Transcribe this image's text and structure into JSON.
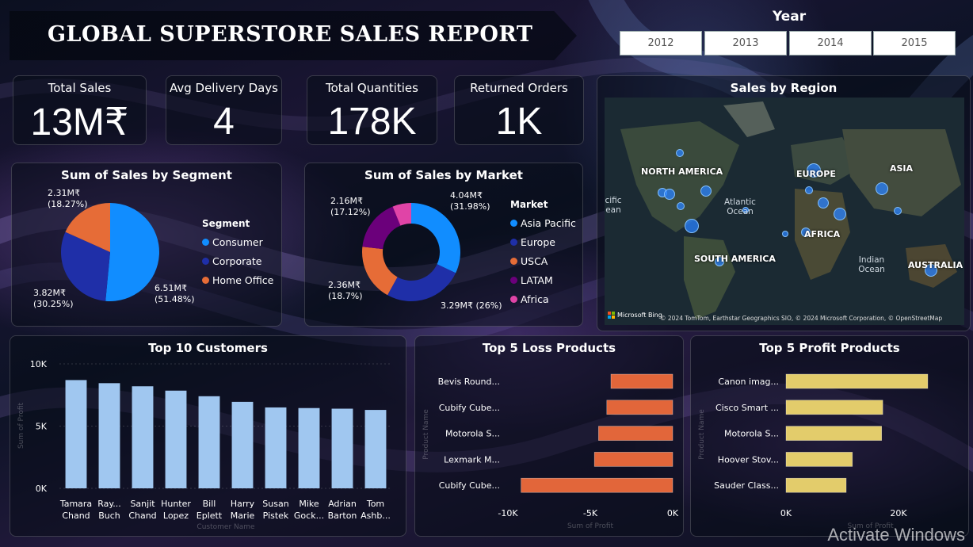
{
  "header": {
    "title": "GLOBAL SUPERSTORE SALES REPORT"
  },
  "year_filter": {
    "label": "Year",
    "options": [
      "2012",
      "2013",
      "2014",
      "2015"
    ]
  },
  "kpis": [
    {
      "label": "Total Sales",
      "value": "13M₹"
    },
    {
      "label": "Avg Delivery Days",
      "value": "4"
    },
    {
      "label": "Total Quantities",
      "value": "178K"
    },
    {
      "label": "Returned Orders",
      "value": "1K"
    }
  ],
  "colors": {
    "consumer": "#118DFF",
    "corporate": "#1F2FA8",
    "home_office": "#E66C37",
    "asia_pacific": "#118DFF",
    "europe": "#1F2FA8",
    "usca": "#E66C37",
    "latam": "#6B007B",
    "africa": "#E044A7",
    "loss_bar": "#E2663A",
    "profit_bar": "#E3CC6B",
    "customer_bar": "#A0C7F0"
  },
  "segment_chart": {
    "title": "Sum of Sales by Segment",
    "legend_title": "Segment",
    "legend": [
      "Consumer",
      "Corporate",
      "Home Office"
    ],
    "labels": [
      {
        "value": "6.51M₹",
        "pct": "(51.48%)"
      },
      {
        "value": "3.82M₹",
        "pct": "(30.25%)"
      },
      {
        "value": "2.31M₹",
        "pct": "(18.27%)"
      }
    ]
  },
  "market_chart": {
    "title": "Sum of Sales by Market",
    "legend_title": "Market",
    "legend": [
      "Asia Pacific",
      "Europe",
      "USCA",
      "LATAM",
      "Africa"
    ],
    "labels": [
      {
        "value": "4.04M₹",
        "pct": "(31.98%)"
      },
      {
        "value": "3.29M₹ (26%)",
        "pct": ""
      },
      {
        "value": "2.36M₹",
        "pct": "(18.7%)"
      },
      {
        "value": "2.16M₹",
        "pct": "(17.12%)"
      }
    ]
  },
  "region_map": {
    "title": "Sales by Region",
    "continents": [
      "NORTH AMERICA",
      "EUROPE",
      "ASIA",
      "AFRICA",
      "SOUTH AMERICA",
      "AUSTRALIA"
    ],
    "oceans": [
      "Atlantic Ocean",
      "Indian Ocean"
    ],
    "partial_label": "cific ean",
    "bing": "Microsoft Bing",
    "attribution": "© 2024 TomTom, Earthstar Geographics SIO, © 2024 Microsoft Corporation, © OpenStreetMap"
  },
  "customers_panel": {
    "title": "Top 10 Customers",
    "xlabel": "Customer Name",
    "ylabel": "Sum of Profit"
  },
  "loss_panel": {
    "title": "Top 5 Loss Products",
    "xlabel": "Sum of Profit",
    "ylabel": "Product Name"
  },
  "profit_panel": {
    "title": "Top 5 Profit Products",
    "xlabel": "Sum of Profit",
    "ylabel": "Product Name"
  },
  "chart_data": [
    {
      "type": "pie",
      "title": "Sum of Sales by Segment",
      "categories": [
        "Consumer",
        "Corporate",
        "Home Office"
      ],
      "values": [
        6.51,
        3.82,
        2.31
      ],
      "percent": [
        51.48,
        30.25,
        18.27
      ],
      "unit": "M₹",
      "legend_position": "right"
    },
    {
      "type": "pie",
      "title": "Sum of Sales by Market",
      "categories": [
        "Asia Pacific",
        "Europe",
        "USCA",
        "LATAM",
        "Africa"
      ],
      "values": [
        4.04,
        3.29,
        2.36,
        2.16,
        0.78
      ],
      "percent": [
        31.98,
        26.0,
        18.7,
        17.12,
        6.2
      ],
      "unit": "M₹",
      "donut": true,
      "legend_position": "right"
    },
    {
      "type": "bar",
      "title": "Top 10 Customers",
      "xlabel": "Customer Name",
      "ylabel": "Sum of Profit",
      "categories": [
        [
          "Tamara",
          "Chand"
        ],
        [
          "Ray...",
          "Buch"
        ],
        [
          "Sanjit",
          "Chand"
        ],
        [
          "Hunter",
          "Lopez"
        ],
        [
          "Bill",
          "Eplett"
        ],
        [
          "Harry",
          "Marie"
        ],
        [
          "Susan",
          "Pistek"
        ],
        [
          "Mike",
          "Gock..."
        ],
        [
          "Adrian",
          "Barton"
        ],
        [
          "Tom",
          "Ashb..."
        ]
      ],
      "values": [
        8700,
        8450,
        8200,
        7850,
        7400,
        6950,
        6500,
        6450,
        6400,
        6300
      ],
      "ylim": [
        0,
        10000
      ],
      "yticks": [
        "0K",
        "5K",
        "10K"
      ]
    },
    {
      "type": "bar",
      "orientation": "horizontal",
      "title": "Top 5 Loss Products",
      "xlabel": "Sum of Profit",
      "ylabel": "Product Name",
      "categories": [
        "Bevis Round...",
        "Cubify Cube...",
        "Motorola S...",
        "Lexmark M...",
        "Cubify Cube..."
      ],
      "values": [
        -3750,
        -4000,
        -4500,
        -4750,
        -9200
      ],
      "xlim": [
        -10000,
        0
      ],
      "xticks": [
        "-10K",
        "-5K",
        "0K"
      ]
    },
    {
      "type": "bar",
      "orientation": "horizontal",
      "title": "Top 5 Profit Products",
      "xlabel": "Sum of Profit",
      "ylabel": "Product Name",
      "categories": [
        "Canon imag...",
        "Cisco Smart ...",
        "Motorola S...",
        "Hoover Stov...",
        "Sauder Class..."
      ],
      "values": [
        25200,
        17200,
        17000,
        11800,
        10700
      ],
      "xlim": [
        0,
        30000
      ],
      "xticks": [
        "0K",
        "20K"
      ]
    }
  ],
  "watermark": "Activate Windows"
}
